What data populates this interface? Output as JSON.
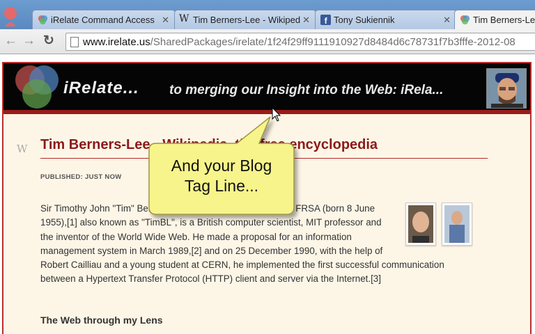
{
  "browser": {
    "tabs": [
      {
        "label": "iRelate Command Access",
        "icon": "irelate-icon",
        "active": false
      },
      {
        "label": "Tim Berners-Lee - Wikiped",
        "icon": "wikipedia-icon",
        "active": false
      },
      {
        "label": "Tony Sukiennik",
        "icon": "facebook-icon",
        "active": false
      },
      {
        "label": "Tim Berners-Lee",
        "icon": "irelate-icon",
        "active": true
      }
    ],
    "address": {
      "host": "www.irelate.us",
      "path": "/SharedPackages/irelate/1f24f29ff9111910927d8484d6c78731f7b3fffe-2012-08"
    },
    "colors": {
      "tab_strip": "#5a89c0",
      "toolbar": "#e3e3e3"
    }
  },
  "site": {
    "brand": "iRelate...",
    "tagline": "to merging our Insight into the Web: iRela...",
    "colors": {
      "banner": "#050505",
      "accent_red": "#9a1b1b",
      "page_bg": "#fdf6e7"
    }
  },
  "article": {
    "title": "Tim Berners-Lee - Wikipedia, the free encyclopedia",
    "published": "PUBLISHED: JUST NOW",
    "body": "Sir Timothy John \"Tim\" Berners-Lee, OM, KBE, FRS, FREng, FRSA (born 8 June 1955),[1] also known as \"TimBL\", is a British computer scientist, MIT professor and the inventor of the World Wide Web. He made a proposal for an information management system in March 1989,[2] and on 25 December 1990, with the help of Robert Cailliau and a young student at CERN, he implemented the first successful communication between a Hypertext Transfer Protocol (HTTP) client and server via the Internet.[3]",
    "section_heading": "The Web through my Lens",
    "title_color": "#8b1a1a"
  },
  "callout": {
    "line1": "And your Blog",
    "line2": "Tag Line...",
    "fill": "#f7f48b"
  }
}
